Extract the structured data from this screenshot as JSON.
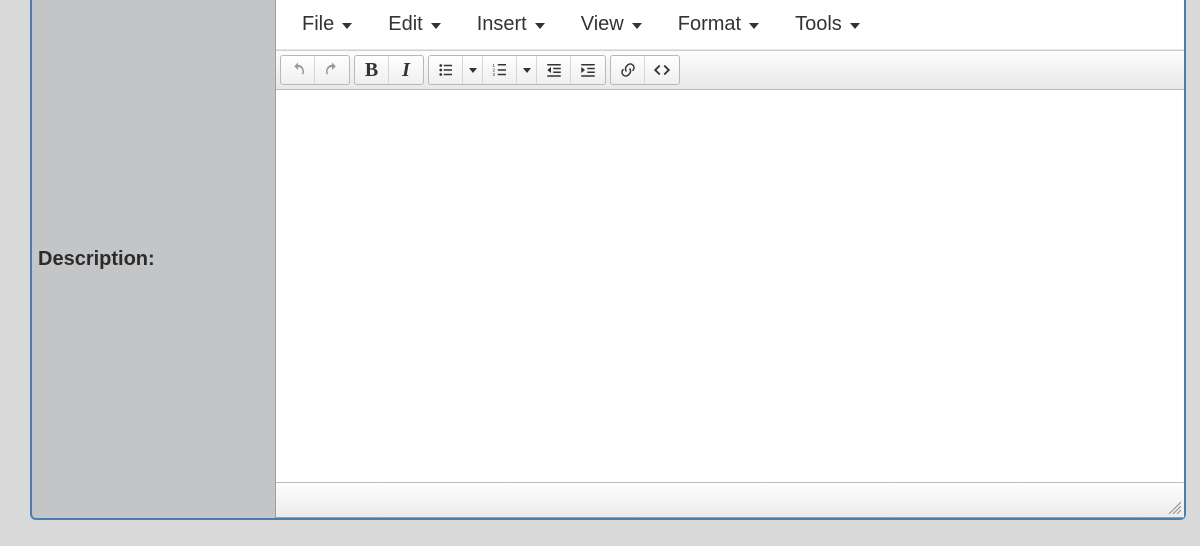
{
  "label": "Description:",
  "menubar": [
    {
      "key": "file",
      "label": "File"
    },
    {
      "key": "edit",
      "label": "Edit"
    },
    {
      "key": "insert",
      "label": "Insert"
    },
    {
      "key": "view",
      "label": "View"
    },
    {
      "key": "format",
      "label": "Format"
    },
    {
      "key": "tools",
      "label": "Tools"
    }
  ],
  "toolbar": {
    "undo": "Undo",
    "redo": "Redo",
    "bold": "B",
    "italic": "I",
    "bullets": "Bullet list",
    "numbered": "Numbered list",
    "outdent": "Decrease indent",
    "indent": "Increase indent",
    "link": "Insert link",
    "html": "Source code"
  },
  "content": ""
}
